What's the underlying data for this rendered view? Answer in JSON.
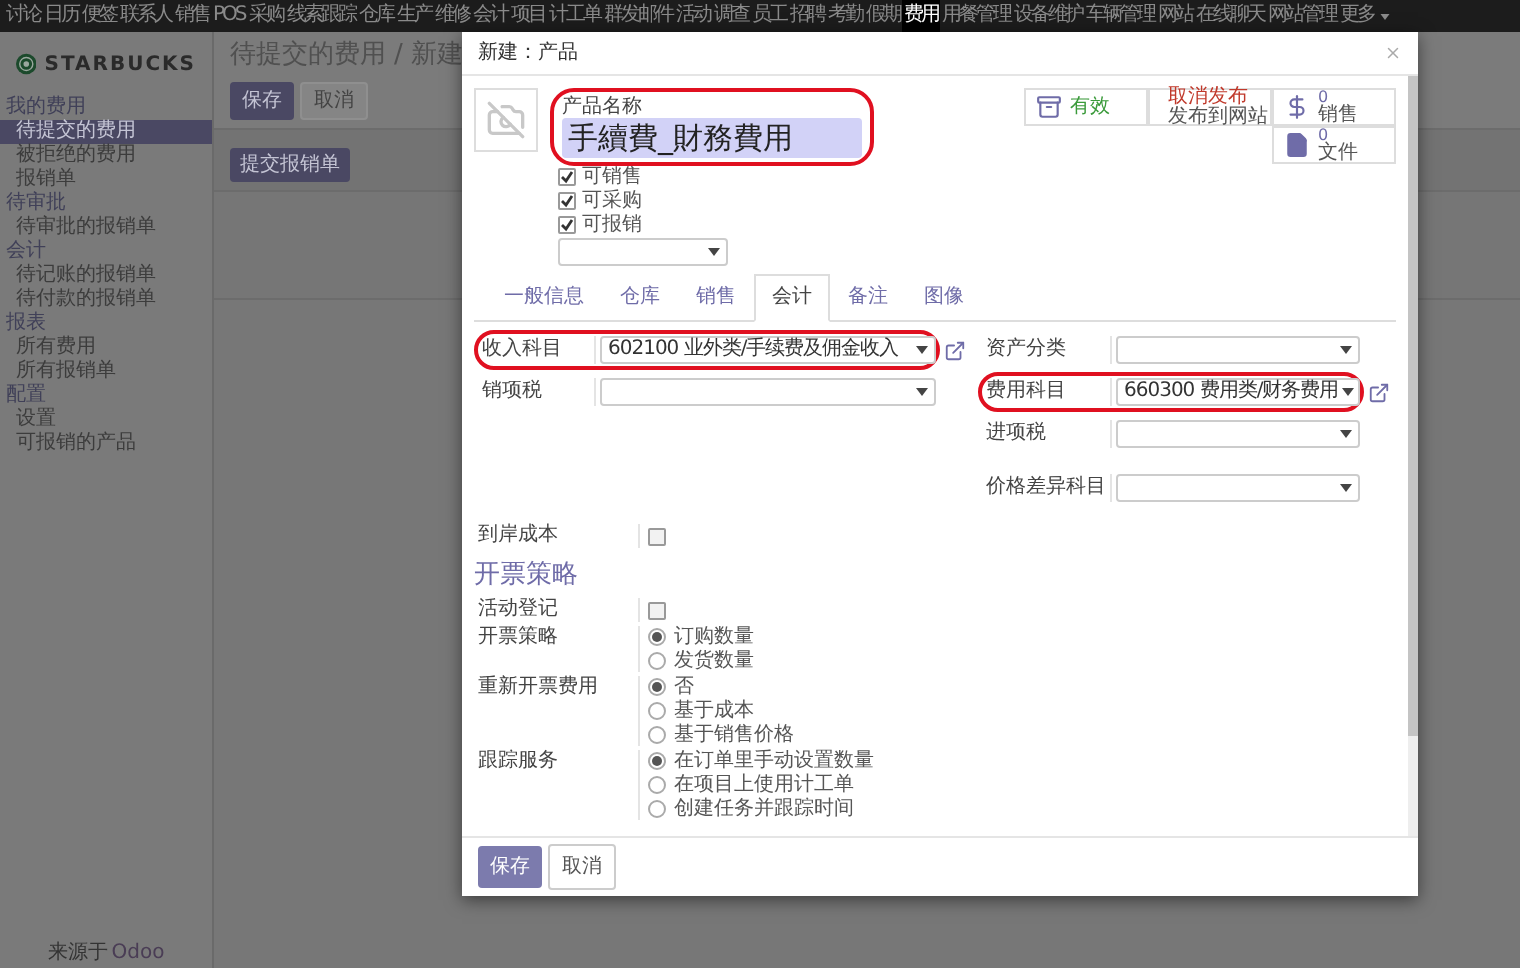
{
  "top_menu": [
    {
      "label": "讨论",
      "selected": false
    },
    {
      "label": "日历",
      "selected": false
    },
    {
      "label": "便签",
      "selected": false
    },
    {
      "label": "联系人",
      "selected": false
    },
    {
      "label": "销售",
      "selected": false
    },
    {
      "label": "POS",
      "selected": false
    },
    {
      "label": "采购",
      "selected": false
    },
    {
      "label": "线索跟踪",
      "selected": false
    },
    {
      "label": "仓库",
      "selected": false
    },
    {
      "label": "生产",
      "selected": false
    },
    {
      "label": "维修",
      "selected": false
    },
    {
      "label": "会计",
      "selected": false
    },
    {
      "label": "项目",
      "selected": false
    },
    {
      "label": "计工单",
      "selected": false
    },
    {
      "label": "群发邮件",
      "selected": false
    },
    {
      "label": "活动",
      "selected": false
    },
    {
      "label": "调查",
      "selected": false
    },
    {
      "label": "员工",
      "selected": false
    },
    {
      "label": "招聘",
      "selected": false
    },
    {
      "label": "考勤",
      "selected": false
    },
    {
      "label": "假期",
      "selected": false
    },
    {
      "label": "费用",
      "selected": true
    },
    {
      "label": "用餐管理",
      "selected": false
    },
    {
      "label": "设备维护",
      "selected": false
    },
    {
      "label": "车辆管理",
      "selected": false
    },
    {
      "label": "网站",
      "selected": false
    },
    {
      "label": "在线聊天",
      "selected": false
    },
    {
      "label": "网站管理",
      "selected": false
    }
  ],
  "more_menu": {
    "label": "更多"
  },
  "sidebar": {
    "logo_text": "STARBUCKS",
    "sections": [
      {
        "title": "我的费用",
        "items": [
          {
            "label": "待提交的费用",
            "selected": true
          },
          {
            "label": "被拒绝的费用",
            "selected": false
          },
          {
            "label": "报销单",
            "selected": false
          }
        ]
      },
      {
        "title": "待审批",
        "items": [
          {
            "label": "待审批的报销单",
            "selected": false
          }
        ]
      },
      {
        "title": "会计",
        "items": [
          {
            "label": "待记账的报销单",
            "selected": false
          },
          {
            "label": "待付款的报销单",
            "selected": false
          }
        ]
      },
      {
        "title": "报表",
        "items": [
          {
            "label": "所有费用",
            "selected": false
          },
          {
            "label": "所有报销单",
            "selected": false
          }
        ]
      },
      {
        "title": "配置",
        "items": [
          {
            "label": "设置",
            "selected": false
          },
          {
            "label": "可报销的产品",
            "selected": false
          }
        ]
      }
    ],
    "powered_by": "来源于",
    "brand": "Odoo"
  },
  "breadcrumb": {
    "items": [
      "待提交的费用",
      "新建"
    ],
    "separator": "/"
  },
  "control_buttons": [
    "保存",
    "取消"
  ],
  "action_button": "提交报销单",
  "dialog": {
    "title": "新建：产品",
    "product_name_label": "产品名称",
    "product_name": "手續費_財務費用",
    "name_highlighted": true,
    "flags": [
      {
        "label": "可销售",
        "checked": true
      },
      {
        "label": "可采购",
        "checked": true
      },
      {
        "label": "可报销",
        "checked": true
      }
    ],
    "stat_buttons": [
      {
        "kind": "archive",
        "label": "有效"
      },
      {
        "kind": "publish",
        "label": "取消发布",
        "sublabel": "发布到网站"
      },
      {
        "kind": "sales",
        "value": "0",
        "label": "销售"
      },
      {
        "kind": "documents",
        "value": "0",
        "label": "文件"
      }
    ],
    "tabs": [
      {
        "label": "一般信息",
        "selected": false
      },
      {
        "label": "仓库",
        "selected": false
      },
      {
        "label": "销售",
        "selected": false
      },
      {
        "label": "会计",
        "selected": true
      },
      {
        "label": "备注",
        "selected": false
      },
      {
        "label": "图像",
        "selected": false
      }
    ],
    "accounting": {
      "left": [
        {
          "label": "收入科目",
          "value": "602100 业外类/手续费及佣金收入",
          "external_link": true,
          "highlighted": true
        },
        {
          "label": "销项税",
          "external_link": false,
          "highlighted": false
        }
      ],
      "right": [
        {
          "label": "资产分类",
          "external_link": false,
          "highlighted": false
        },
        {
          "label": "费用科目",
          "value": "660300 费用类/财务费用",
          "external_link": true,
          "highlighted": true
        },
        {
          "label": "进项税",
          "external_link": false,
          "highlighted": false
        },
        {
          "label": "价格差异科目",
          "external_link": false,
          "highlighted": false
        }
      ]
    },
    "landed_cost": {
      "label": "到岸成本",
      "checked": false
    },
    "invoicing": {
      "title": "开票策略",
      "fields": [
        {
          "kind": "checkbox",
          "label": "活动登记",
          "checked": false
        },
        {
          "kind": "radio",
          "label": "开票策略",
          "options": [
            {
              "label": "订购数量",
              "selected": true
            },
            {
              "label": "发货数量",
              "selected": false
            }
          ]
        },
        {
          "kind": "radio",
          "label": "重新开票费用",
          "options": [
            {
              "label": "否",
              "selected": true
            },
            {
              "label": "基于成本",
              "selected": false
            },
            {
              "label": "基于销售价格",
              "selected": false
            }
          ]
        },
        {
          "kind": "radio",
          "label": "跟踪服务",
          "options": [
            {
              "label": "在订单里手动设置数量",
              "selected": true
            },
            {
              "label": "在项目上使用计工单",
              "selected": false
            },
            {
              "label": "创建任务并跟踪时间",
              "selected": false
            }
          ]
        }
      ]
    },
    "footer_buttons": [
      "保存",
      "取消"
    ]
  }
}
